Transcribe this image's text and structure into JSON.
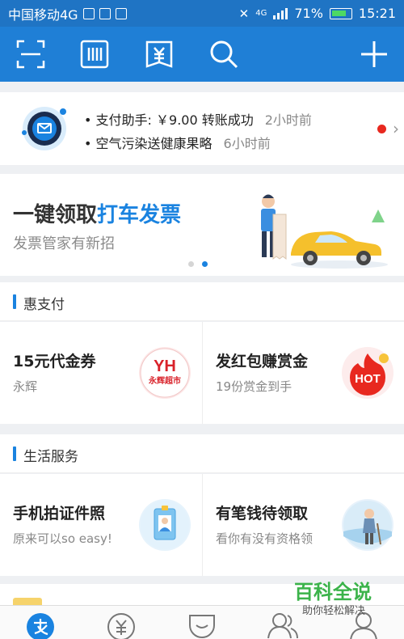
{
  "status_bar": {
    "carrier": "中国移动4G",
    "network": "4G",
    "battery": "71%",
    "time": "15:21"
  },
  "toolbar": {
    "buttons": [
      "scan-icon",
      "barcode-pay-icon",
      "wallet-yuan-icon",
      "search-icon",
      "add-icon"
    ]
  },
  "notifications": {
    "items": [
      {
        "text": "支付助手: ￥9.00 转账成功",
        "time": "2小时前"
      },
      {
        "text": "空气污染送健康果略",
        "time": "6小时前"
      }
    ]
  },
  "banner": {
    "title_plain": "一键领取",
    "title_highlight": "打车发票",
    "subtitle": "发票管家有新招",
    "page_count": 2,
    "active_page": 2
  },
  "sections": [
    {
      "label": "惠支付",
      "tiles": [
        {
          "title": "15元代金券",
          "subtitle": "永辉",
          "logo_text": "YH",
          "logo_caption": "永辉超市"
        },
        {
          "title": "发红包赚赏金",
          "subtitle": "19份赏金到手",
          "logo_text": "HOT"
        }
      ]
    },
    {
      "label": "生活服务",
      "tiles": [
        {
          "title": "手机拍证件照",
          "subtitle": "原来可以so easy!"
        },
        {
          "title": "有笔钱待领取",
          "subtitle": "看你有没有资格领"
        }
      ]
    }
  ],
  "tabbar": {
    "tabs": [
      "alipay-home-icon",
      "wealth-yuan-icon",
      "koubei-icon",
      "friends-icon",
      "me-icon"
    ]
  },
  "watermark": {
    "main": "百科全说",
    "sub": "助你轻松解决"
  },
  "colors": {
    "primary": "#1f7fd6",
    "status_bar": "#1f74c4",
    "accent": "#1a83e0",
    "badge_red": "#e8281f",
    "watermark_green": "#3bb34a"
  }
}
